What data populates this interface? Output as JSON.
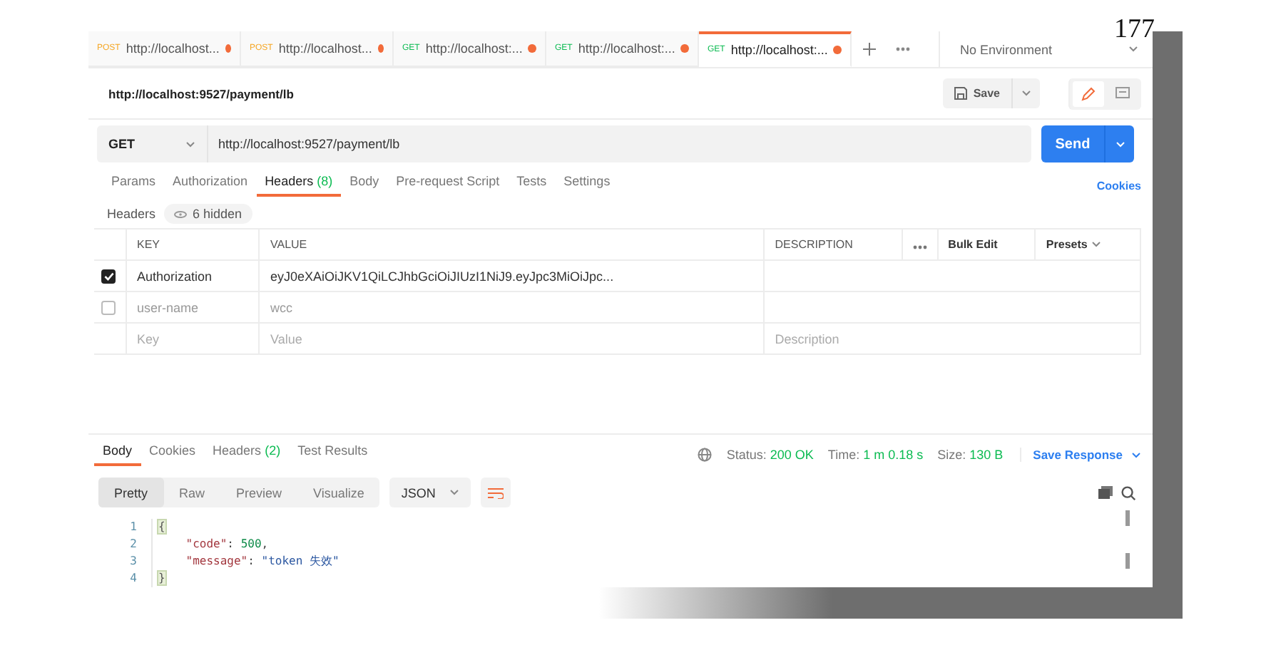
{
  "page_number": "177",
  "tabs": [
    {
      "method": "POST",
      "label": "http://localhost...",
      "unsaved": true,
      "selected": false
    },
    {
      "method": "POST",
      "label": "http://localhost...",
      "unsaved": true,
      "selected": false
    },
    {
      "method": "GET",
      "label": "http://localhost:...",
      "unsaved": true,
      "selected": false
    },
    {
      "method": "GET",
      "label": "http://localhost:...",
      "unsaved": true,
      "selected": false
    },
    {
      "method": "GET",
      "label": "http://localhost:...",
      "unsaved": true,
      "selected": true
    }
  ],
  "environment": "No Environment",
  "request": {
    "title": "http://localhost:9527/payment/lb",
    "save": "Save",
    "method": "GET",
    "url": "http://localhost:9527/payment/lb",
    "send": "Send"
  },
  "request_tabs": [
    {
      "label": "Params",
      "selected": false
    },
    {
      "label": "Authorization",
      "selected": false
    },
    {
      "label": "Headers",
      "count": "(8)",
      "selected": true
    },
    {
      "label": "Body",
      "selected": false
    },
    {
      "label": "Pre-request Script",
      "selected": false
    },
    {
      "label": "Tests",
      "selected": false
    },
    {
      "label": "Settings",
      "selected": false
    }
  ],
  "cookies_link": "Cookies",
  "headers_label": "Headers",
  "hidden_badge": "6 hidden",
  "table": {
    "columns": [
      "KEY",
      "VALUE",
      "DESCRIPTION"
    ],
    "bulk_edit": "Bulk Edit",
    "presets": "Presets",
    "rows": [
      {
        "kind": "param",
        "checked": true,
        "key": "Authorization",
        "value": "eyJ0eXAiOiJKV1QiLCJhbGciOiJIUzI1NiJ9.eyJpc3MiOiJpc..."
      },
      {
        "kind": "param",
        "checked": false,
        "key": "user-name",
        "value": "wcc"
      },
      {
        "kind": "new",
        "key": "Key",
        "value": "Value",
        "description": "Description"
      }
    ]
  },
  "response": {
    "tabs": [
      {
        "label": "Body",
        "selected": true
      },
      {
        "label": "Cookies",
        "selected": false
      },
      {
        "label": "Headers",
        "count": "(2)",
        "selected": false
      },
      {
        "label": "Test Results",
        "selected": false
      }
    ],
    "stats": [
      {
        "label": "Status:",
        "value": "200 OK"
      },
      {
        "label": "Time:",
        "value": "1 m 0.18 s"
      },
      {
        "label": "Size:",
        "value": "130 B"
      }
    ],
    "save_response": "Save Response",
    "views": [
      {
        "label": "Pretty",
        "selected": true
      },
      {
        "label": "Raw",
        "selected": false
      },
      {
        "label": "Preview",
        "selected": false
      },
      {
        "label": "Visualize",
        "selected": false
      }
    ],
    "format": "JSON",
    "lines": [
      {
        "number": "1",
        "parts": [
          {
            "kind": "bracket",
            "text": "{"
          }
        ]
      },
      {
        "number": "2",
        "parts": [
          {
            "kind": "key",
            "text": "    \"code\""
          },
          {
            "kind": "punct",
            "text": ": "
          },
          {
            "kind": "number",
            "text": "500"
          },
          {
            "kind": "punct",
            "text": ","
          }
        ]
      },
      {
        "number": "3",
        "parts": [
          {
            "kind": "key",
            "text": "    \"message\""
          },
          {
            "kind": "punct",
            "text": ": "
          },
          {
            "kind": "string",
            "text": "\"token 失效\""
          }
        ]
      },
      {
        "number": "4",
        "parts": [
          {
            "kind": "bracket",
            "text": "}"
          }
        ]
      }
    ]
  }
}
